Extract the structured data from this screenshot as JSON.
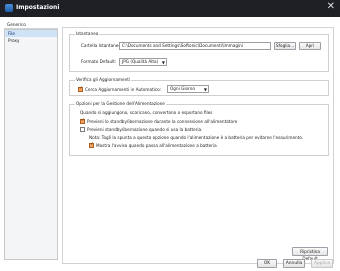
{
  "window": {
    "title": "Impostazioni",
    "close_glyph": "✕"
  },
  "sidebar": {
    "header": "Generico",
    "items": [
      {
        "label": "File"
      },
      {
        "label": "Proxy"
      }
    ]
  },
  "groups": {
    "directory": {
      "legend": "Istantanea",
      "folder_label": "Cartella Istantanee:",
      "folder_value": "C:\\Documents and Settings\\Softonic\\Documenti\\Immagini",
      "browse_label": "Sfoglia...",
      "open_label": "Apri",
      "format_label": "Formato Default:",
      "format_value": "JPG (Qualità Alta)"
    },
    "updates": {
      "legend": "Verifica gli Aggiornamenti",
      "auto_label": "Cerca Aggiornamenti in Automatico:",
      "frequency_value": "Ogni Giorno"
    },
    "power": {
      "legend": "Opzioni per la Gestione dell'Alimentazione",
      "intro": "Quando si aggiungono, scaricano, convertono o esportano files",
      "opt1": "Previeni lo standby/ibernazione durante la connessione all'alimentatore",
      "opt2": "Previeni standby/ibernazione quando si usa la batteria.",
      "note": "Nota: Togli la spunta a questa opzione quando l'alimentazione è a batteria per evitarne l'esaurimento.",
      "opt3": "Mostra l'avviso quando passa all'alimentazione a batteria"
    }
  },
  "buttons": {
    "restore_defaults": "Ripristina Default",
    "ok": "OK",
    "cancel": "Annulla",
    "apply": "Applica"
  }
}
